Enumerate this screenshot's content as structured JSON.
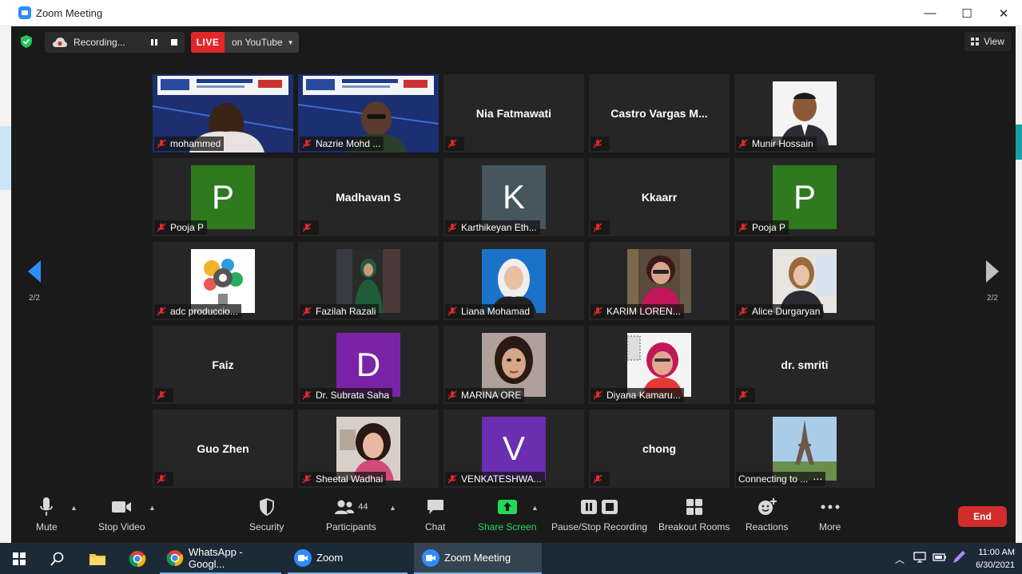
{
  "window": {
    "title": "Zoom Meeting",
    "minimize": "—",
    "maximize": "☐",
    "close": "✕"
  },
  "recording": {
    "text": "Recording..."
  },
  "live": {
    "badge": "LIVE",
    "platform": "on YouTube"
  },
  "view": {
    "label": "View"
  },
  "pagination": {
    "left": "2/2",
    "right": "2/2"
  },
  "tiles": [
    {
      "name": "mohammed",
      "kind": "video"
    },
    {
      "name": "Nazrie Mohd ...",
      "kind": "video"
    },
    {
      "name": "Nia Fatmawati",
      "kind": "name"
    },
    {
      "name": "Castro Vargas M...",
      "kind": "name"
    },
    {
      "name": "Munir Hossain",
      "kind": "photo"
    },
    {
      "name": "Pooja P",
      "kind": "avatar",
      "letter": "P",
      "color": "#2f7a1f"
    },
    {
      "name": "Madhavan S",
      "kind": "name"
    },
    {
      "name": "Karthikeyan Eth...",
      "kind": "avatar",
      "letter": "K",
      "color": "#46555e"
    },
    {
      "name": "Kkaarr",
      "kind": "name"
    },
    {
      "name": "Pooja P",
      "kind": "avatar",
      "letter": "P",
      "color": "#2f7a1f"
    },
    {
      "name": "adc produccio...",
      "kind": "photo"
    },
    {
      "name": "Fazilah Razali",
      "kind": "photo"
    },
    {
      "name": "Liana Mohamad",
      "kind": "photo"
    },
    {
      "name": "KARIM LOREN...",
      "kind": "photo"
    },
    {
      "name": "Alice Durgaryan",
      "kind": "photo"
    },
    {
      "name": "Faiz",
      "kind": "name"
    },
    {
      "name": "Dr. Subrata Saha",
      "kind": "avatar",
      "letter": "D",
      "color": "#7b23a6"
    },
    {
      "name": "MARINA ORE",
      "kind": "photo"
    },
    {
      "name": "Diyana Kamaru...",
      "kind": "photo"
    },
    {
      "name": "dr. smriti",
      "kind": "name"
    },
    {
      "name": "Guo Zhen",
      "kind": "name"
    },
    {
      "name": "Sheetal Wadhai",
      "kind": "photo"
    },
    {
      "name": "VENKATESHWA...",
      "kind": "avatar",
      "letter": "V",
      "color": "#6a2fb0"
    },
    {
      "name": "chong",
      "kind": "name"
    },
    {
      "name": "Connecting to ...",
      "kind": "photo"
    }
  ],
  "toolbar": {
    "mute": "Mute",
    "stop_video": "Stop Video",
    "security": "Security",
    "participants": "Participants",
    "participants_count": "44",
    "chat": "Chat",
    "share_screen": "Share Screen",
    "pause_stop_recording": "Pause/Stop Recording",
    "breakout_rooms": "Breakout Rooms",
    "reactions": "Reactions",
    "more": "More",
    "end": "End"
  },
  "taskbar": {
    "whatsapp": "WhatsApp - Googl...",
    "zoom": "Zoom",
    "zoom_meeting": "Zoom Meeting",
    "time": "11:00 AM",
    "date": "6/30/2021"
  },
  "colors": {
    "live": "#e02828",
    "share_green": "#23d959",
    "end_red": "#d22c2c",
    "zoom_blue": "#2d8cff"
  }
}
